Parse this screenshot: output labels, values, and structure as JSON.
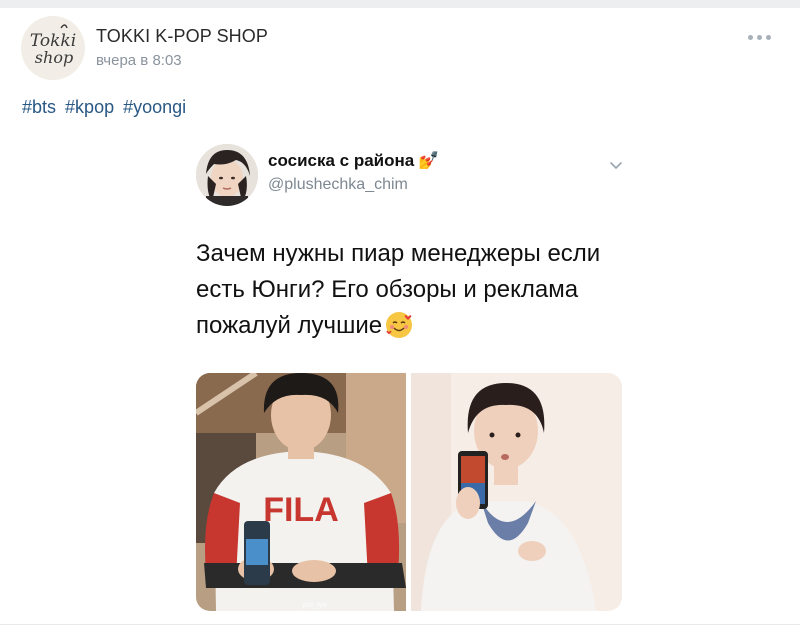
{
  "post": {
    "author": "TOKKI K-POP SHOP",
    "time": "вчера в 8:03",
    "avatar_text_top": "Tokki",
    "avatar_text_bottom": "shop",
    "tags": [
      "#bts",
      "#kpop",
      "#yoongi"
    ]
  },
  "tweet": {
    "display_name": "сосиска с района",
    "name_emoji": "💅",
    "handle": "@plushechka_chim",
    "text_lines": [
      "Зачем нужны пиар менеджеры если",
      "есть Юнги? Его обзоры и реклама",
      "пожалуй лучшие"
    ],
    "text_emoji": "🥰",
    "photo_left_shirt_text": "FILA",
    "photo_left_watermark": "yoo_fye"
  },
  "colors": {
    "link": "#2a5885",
    "meta": "#8a939e",
    "band": "#edeef0"
  }
}
